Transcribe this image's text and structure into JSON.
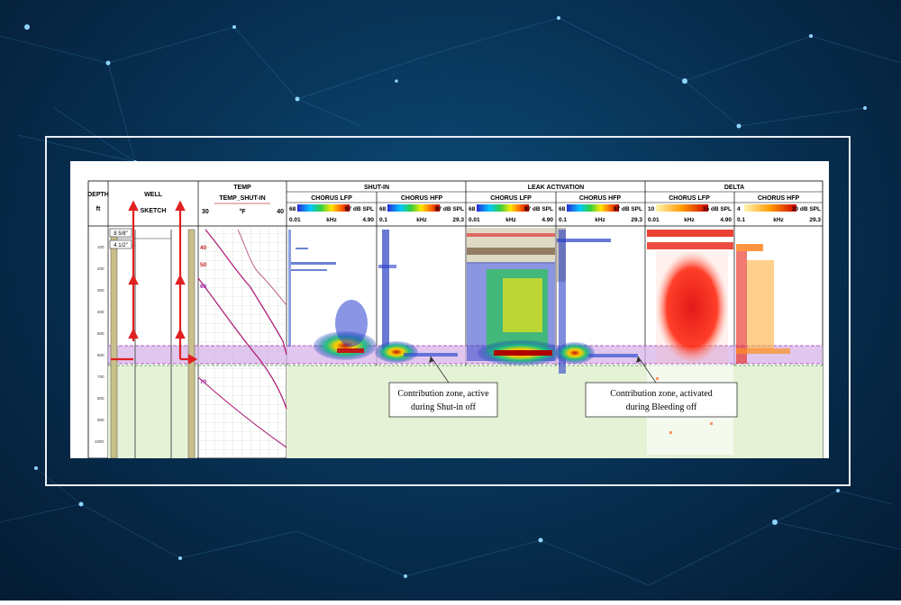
{
  "headers": {
    "depth": "DEPTH",
    "depth_unit": "ft",
    "well": "WELL",
    "well_sketch": "SKETCH",
    "temp": "TEMP",
    "temp_track": "TEMP_SHUT-IN",
    "temp_min": "30",
    "temp_unit": "°F",
    "temp_max": "40",
    "shutin": "SHUT-IN",
    "leak": "LEAK ACTIVATION",
    "delta": "DELTA"
  },
  "subtracks": [
    {
      "name": "CHORUS LFP",
      "scale_min": "68",
      "scale_max": "97 dB SPL",
      "freq_min": "0.01",
      "freq_unit": "kHz",
      "freq_max": "4.90"
    },
    {
      "name": "CHORUS HFP",
      "scale_min": "68",
      "scale_max": "97 dB SPL",
      "freq_min": "0.1",
      "freq_unit": "kHz",
      "freq_max": "29.3"
    },
    {
      "name": "CHORUS LFP",
      "scale_min": "68",
      "scale_max": "97 dB SPL",
      "freq_min": "0.01",
      "freq_unit": "kHz",
      "freq_max": "4.90"
    },
    {
      "name": "CHORUS HFP",
      "scale_min": "68",
      "scale_max": "97 dB SPL",
      "freq_min": "0.1",
      "freq_unit": "kHz",
      "freq_max": "29.3"
    },
    {
      "name": "CHORUS LFP",
      "scale_min": "10",
      "scale_max": "15 dB SPL",
      "freq_min": "0.01",
      "freq_unit": "kHz",
      "freq_max": "4.90"
    },
    {
      "name": "CHORUS HFP",
      "scale_min": "4",
      "scale_max": "20 dB SPL",
      "freq_min": "0.1",
      "freq_unit": "kHz",
      "freq_max": "29.3"
    }
  ],
  "casing": {
    "outer": "8 5/8\"",
    "inner": "4 1/2\""
  },
  "temp_values": [
    "40",
    "50",
    "60",
    "70"
  ],
  "depth_ticks": [
    "100",
    "200",
    "300",
    "400",
    "500",
    "600",
    "700",
    "800",
    "900",
    "1000"
  ],
  "callouts": {
    "left_line1": "Contribution zone, active",
    "left_line2": "during Shut-in off",
    "right_line1": "Contribution zone, activated",
    "right_line2": "during Bleeding off"
  },
  "colors": {
    "zone": "#d7b3e8",
    "below_zone": "#e6f2d6",
    "arrow": "#e02020",
    "curve": "#b0207a"
  }
}
